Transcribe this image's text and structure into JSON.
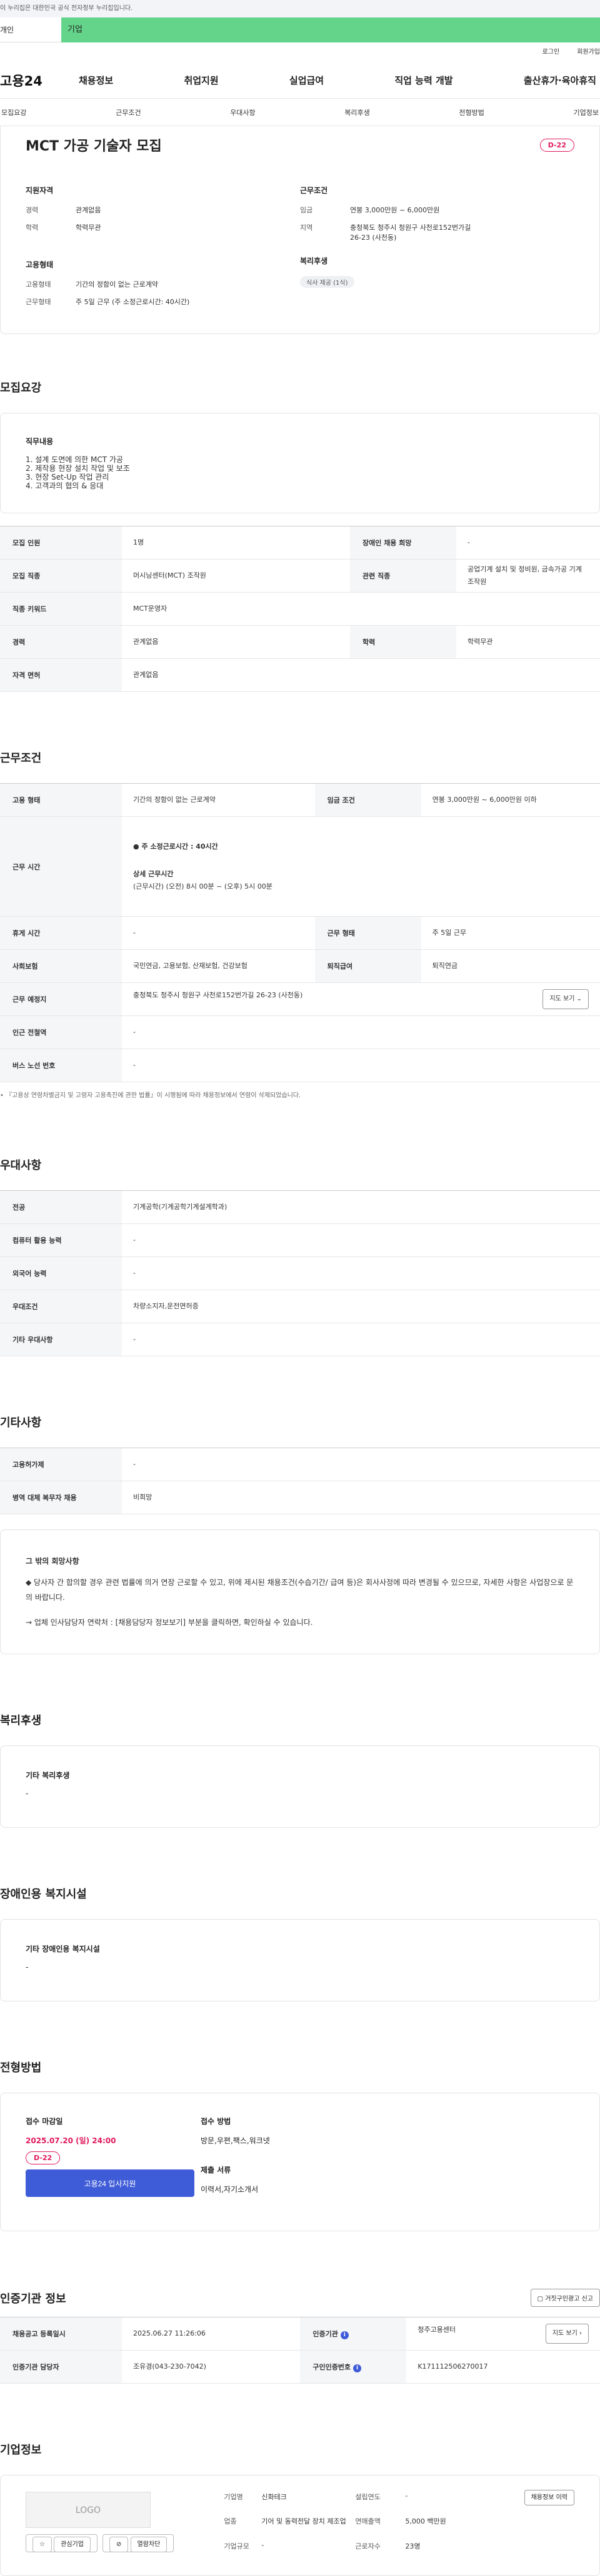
{
  "gov_bar": "이 누리집은 대한민국 공식 전자정부 누리집입니다.",
  "top_tabs": [
    "개인",
    "기업"
  ],
  "util": [
    "로그인",
    "회원가입"
  ],
  "gnb": {
    "logo": "고용24",
    "menu": [
      "채용정보",
      "취업지원",
      "실업급여",
      "직업 능력 개발",
      "출산휴가·육아휴직"
    ]
  },
  "subnav": [
    "모집요강",
    "근무조건",
    "우대사항",
    "복리후생",
    "전형방법",
    "기업정보"
  ],
  "summary": {
    "title": "MCT 가공 기술자 모집",
    "dday": "D-22",
    "qual_title": "지원자격",
    "qual": [
      {
        "k": "경력",
        "v": "관계없음"
      },
      {
        "k": "학력",
        "v": "학력무관"
      }
    ],
    "cond_title": "근무조건",
    "cond": [
      {
        "k": "임금",
        "v": "연봉 3,000만원 ~ 6,000만원"
      },
      {
        "k": "지역",
        "v": "충청북도 청주시 청원구 사천로152번가길 26-23 (사천동)"
      }
    ],
    "emp_title": "고용형태",
    "emp": [
      {
        "k": "고용형태",
        "v": "기간의 정함이 없는 근로계약"
      },
      {
        "k": "근무형태",
        "v": "주 5일 근무 (주 소정근로시간: 40시간)"
      }
    ],
    "welfare_title": "복리후생",
    "welfare_chip": "식사 제공 (1식)"
  },
  "recruit": {
    "title": "모집요강",
    "duty_title": "직무내용",
    "duties": [
      "1. 설계 도면에 의한 MCT 가공",
      "2. 제작용 현장 설치 작업 및 보조",
      "3. 현장 Set-Up 작업 관리",
      "4. 고객과의 협의 & 응대"
    ],
    "rows": [
      {
        "k1": "모집 인원",
        "v1": "1명",
        "k2": "장애인 채용 희망",
        "v2": "-"
      },
      {
        "k1": "모집 직종",
        "v1": "머시닝센터(MCT) 조작원",
        "k2": "관련 직종",
        "v2": "공업기계 설치 및 정비원, 금속가공 기계 조작원"
      },
      {
        "k1": "직종 키워드",
        "v1": "MCT운영자"
      },
      {
        "k1": "경력",
        "v1": "관계없음",
        "k2": "학력",
        "v2": "학력무관"
      },
      {
        "k1": "자격 면허",
        "v1": "관계없음"
      }
    ]
  },
  "work": {
    "title": "근무조건",
    "emp_k": "고용 형태",
    "emp_v": "기간의 정함이 없는 근로계약",
    "wage_k": "임금 조건",
    "wage_v": "연봉 3,000만원 ~ 6,000만원 이하",
    "time_k": "근무 시간",
    "time_main": "주 소정근로시간 : 40시간",
    "time_detail_title": "상세 근무시간",
    "time_detail": "(근무시간) (오전) 8시 00분 ~ (오후) 5시 00분",
    "rest_k": "휴게 시간",
    "rest_v": "-",
    "form_k": "근무 형태",
    "form_v": "주 5일 근무",
    "ins_k": "사회보험",
    "ins_v": "국민연금, 고용보험, 산재보험, 건강보험",
    "ret_k": "퇴직급여",
    "ret_v": "퇴직연금",
    "place_k": "근무 예정지",
    "place_v": "충청북도 청주시 청원구 사천로152번가길 26-23 (사천동)",
    "map_btn": "지도 보기",
    "sub_k": "인근 전철역",
    "sub_v": "-",
    "bus_k": "버스 노선 번호",
    "bus_v": "-",
    "note": "『고용상 연령차별금지 및 고령자 고용촉진에 관한 법률』이 시행됨에 따라 채용정보에서 연령이 삭제되었습니다."
  },
  "pref": {
    "title": "우대사항",
    "rows": [
      {
        "k": "전공",
        "v": "기계공학(기계공학기계설계학과)"
      },
      {
        "k": "컴퓨터 활용 능력",
        "v": "-"
      },
      {
        "k": "외국어 능력",
        "v": "-"
      },
      {
        "k": "우대조건",
        "v": "차량소지자,운전면허증"
      },
      {
        "k": "기타 우대사항",
        "v": "-"
      }
    ]
  },
  "etc": {
    "title": "기타사항",
    "rows": [
      {
        "k": "고용허가제",
        "v": "-"
      },
      {
        "k": "병역 대체 복무자 채용",
        "v": "비희망"
      }
    ],
    "notice_title": "그 밖의 회망사항",
    "notice_1": "◆ 당사자 간 합의할 경우 관련 법률에 의거 연장 근로할 수 있고, 위에 제시된 채용조건(수습기간/ 급여 등)은 회사사정에 따라 변경될 수 있으므로, 자세한 사항은 사업장으로 문의 바랍니다.",
    "notice_2": "→ 업체 인사담당자 연락처 : [채용담당자 정보보기] 부분을 클릭하면, 확인하실 수 있습니다."
  },
  "welfare": {
    "title": "복리후생",
    "sub": "기타 복리후생",
    "value": "-"
  },
  "disabled": {
    "title": "장애인용 복지시설",
    "sub": "기타 장애인용 복지시설",
    "value": "-"
  },
  "process": {
    "title": "전형방법",
    "deadline_title": "접수 마감일",
    "deadline": "2025.07.20 (일) 24:00",
    "dday": "D-22",
    "apply_btn": "고용24 입사지원",
    "method_title": "접수 방법",
    "method": "방문,우편,팩스,워크넷",
    "docs_title": "제출 서류",
    "docs": "이력서,자기소개서"
  },
  "agency": {
    "title": "인증기관 정보",
    "report_btn": "거짓구인광고 신고",
    "reg_k": "채용공고 등록일시",
    "reg_v": "2025.06.27 11:26:06",
    "org_k": "인증기관",
    "org_v": "청주고용센터",
    "map_btn": "지도 보기",
    "staff_k": "인증기관 담당자",
    "staff_v": "조유경(043-230-7042)",
    "num_k": "구인인증번호",
    "num_v": "K171112506270017"
  },
  "company": {
    "title": "기업정보",
    "logo": "LOGO",
    "fav_btn": "관심기업",
    "block_btn": "열람차단",
    "info_btn": "채용정보 이력",
    "fields": [
      {
        "k": "기업명",
        "v": "신화테크"
      },
      {
        "k": "설립연도",
        "v": "-"
      },
      {
        "k": "업종",
        "v": "기어 및 동력전달 장치 제조업"
      },
      {
        "k": "연매출액",
        "v": "5,000 백만원"
      },
      {
        "k": "기업규모",
        "v": "-"
      },
      {
        "k": "근로자수",
        "v": "23명"
      }
    ]
  }
}
